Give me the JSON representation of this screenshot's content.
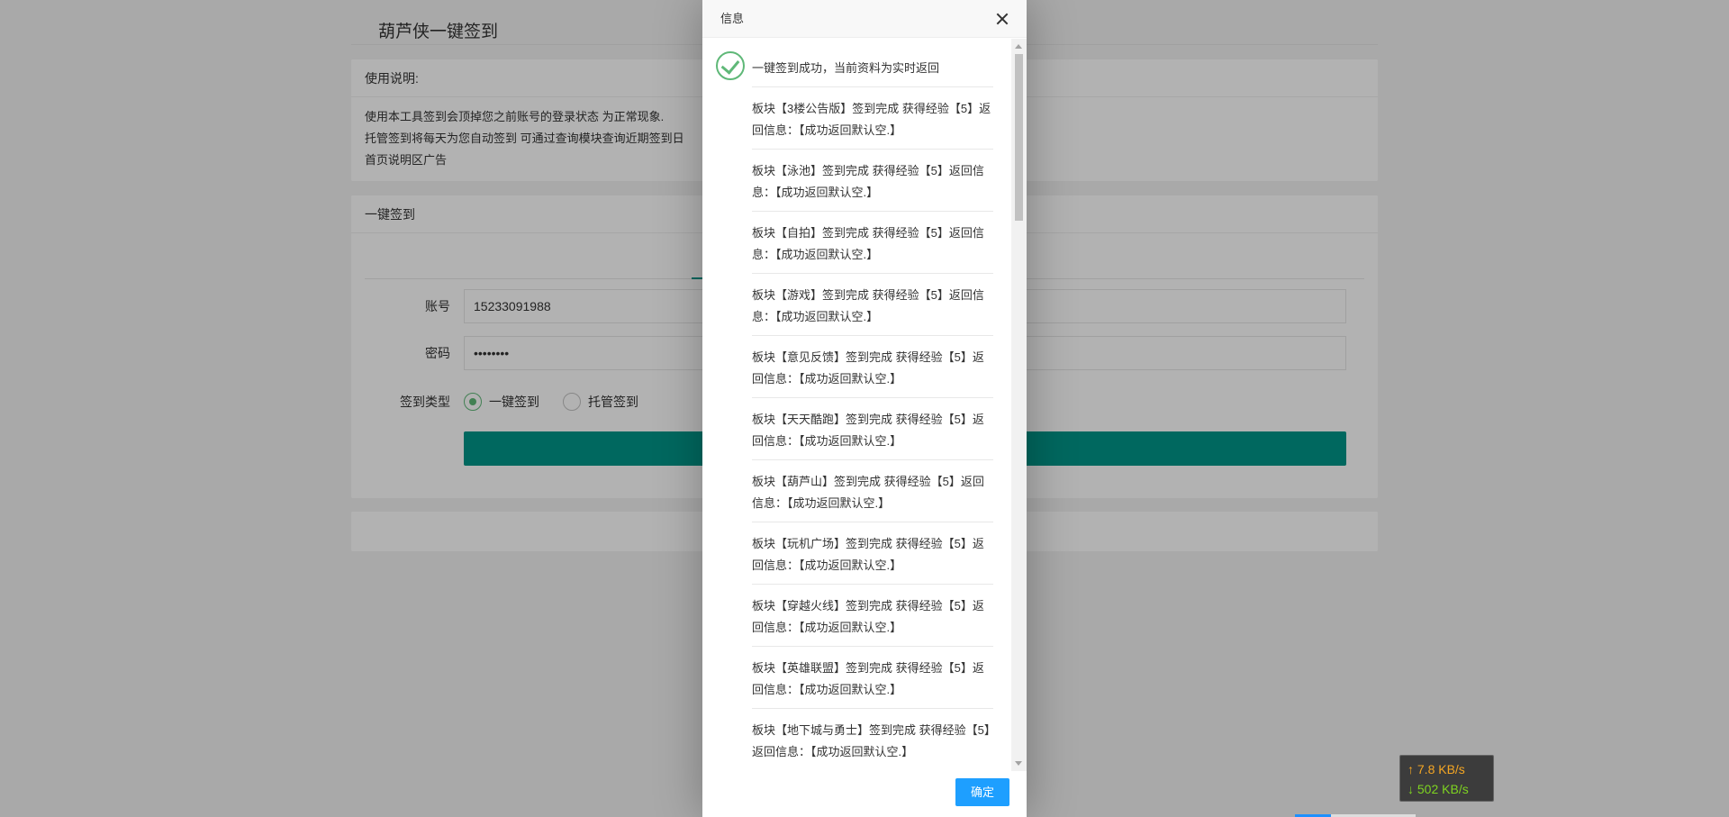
{
  "page": {
    "title": "葫芦侠一键签到"
  },
  "instructions": {
    "heading": "使用说明:",
    "lines": [
      "使用本工具签到会顶掉您之前账号的登录状态 为正常现象.",
      "托管签到将每天为您自动签到 可通过查询模块查询近期签到日",
      "首页说明区广告"
    ]
  },
  "signin": {
    "heading": "一键签到",
    "account_label": "账号",
    "account_value": "15233091988",
    "password_label": "密码",
    "password_value": "••••••••",
    "type_label": "签到类型",
    "options": [
      {
        "label": "一键签到",
        "selected": true
      },
      {
        "label": "托管签到",
        "selected": false
      }
    ]
  },
  "dialog": {
    "title": "信息",
    "head_message": "一键签到成功，当前资料为实时返回",
    "messages": [
      "板块【3楼公告版】签到完成 获得经验【5】返回信息：【成功返回默认空.】",
      "板块【泳池】签到完成 获得经验【5】返回信息：【成功返回默认空.】",
      "板块【自拍】签到完成 获得经验【5】返回信息：【成功返回默认空.】",
      "板块【游戏】签到完成 获得经验【5】返回信息：【成功返回默认空.】",
      "板块【意见反馈】签到完成 获得经验【5】返回信息：【成功返回默认空.】",
      "板块【天天酷跑】签到完成 获得经验【5】返回信息：【成功返回默认空.】",
      "板块【葫芦山】签到完成 获得经验【5】返回信息：【成功返回默认空.】",
      "板块【玩机广场】签到完成 获得经验【5】返回信息：【成功返回默认空.】",
      "板块【穿越火线】签到完成 获得经验【5】返回信息：【成功返回默认空.】",
      "板块【英雄联盟】签到完成 获得经验【5】返回信息：【成功返回默认空.】",
      "板块【地下城与勇士】签到完成 获得经验【5】返回信息：【成功返回默认空.】"
    ],
    "ok_label": "确定"
  },
  "network": {
    "upload": "↑ 7.8 KB/s",
    "download": "↓ 502 KB/s"
  },
  "colors": {
    "accent": "#009688",
    "success": "#5fb878",
    "primary_button": "#1e9fff"
  },
  "icons": [
    "check-circle-icon",
    "close-icon"
  ]
}
